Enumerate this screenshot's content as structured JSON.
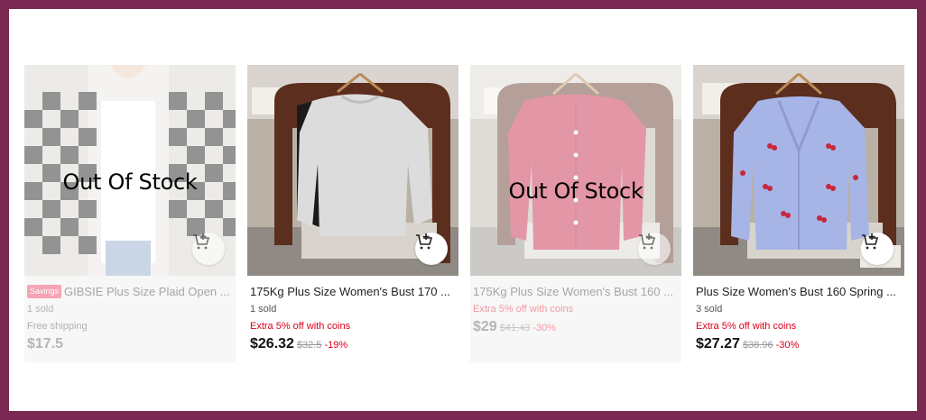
{
  "products": [
    {
      "out_of_stock_label": "Out Of Stock",
      "badge": "Savings",
      "title": "GIBSIE Plus Size Plaid Open ...",
      "sold": "1 sold",
      "shipping": "Free shipping",
      "price": "$17.5",
      "image_icon": "checkered-cardigan-image"
    },
    {
      "title": "175Kg Plus Size Women's Bust 170 ...",
      "sold": "1 sold",
      "promo": "Extra 5% off with coins",
      "price": "$26.32",
      "original_price": "$32.5",
      "discount": "-19%",
      "image_icon": "grey-sweatshirt-image"
    },
    {
      "out_of_stock_label": "Out Of Stock",
      "title": "175Kg Plus Size Women's Bust 160 ...",
      "promo": "Extra 5% off with coins",
      "price": "$29",
      "original_price": "$41.43",
      "discount": "-30%",
      "image_icon": "red-cardigan-image"
    },
    {
      "title": "Plus Size Women's Bust 160 Spring ...",
      "sold": "3 sold",
      "promo": "Extra 5% off with coins",
      "price": "$27.27",
      "original_price": "$38.96",
      "discount": "-30%",
      "image_icon": "blue-cherry-cardigan-image"
    }
  ],
  "icons": {
    "cart": "add-to-cart-icon"
  },
  "colors": {
    "frame": "#7a2a52",
    "promo_red": "#d9001b",
    "badge_pink": "#f6a3b4"
  }
}
